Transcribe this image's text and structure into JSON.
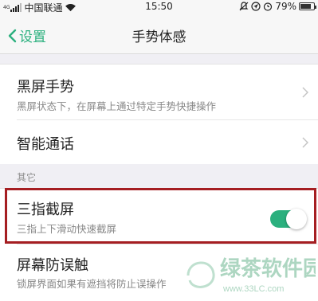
{
  "status_bar": {
    "network": "4G",
    "carrier": "中国联通",
    "time": "15:50",
    "battery": "79%",
    "battery_level": 0.79
  },
  "nav": {
    "back_label": "设置",
    "title": "手势体感"
  },
  "group1": [
    {
      "title": "黑屏手势",
      "subtitle": "黑屏状态下，在屏幕上通过特定手势快捷操作"
    },
    {
      "title": "智能通话"
    }
  ],
  "section_other": "其它",
  "group2": [
    {
      "title": "三指截屏",
      "subtitle": "三指上下滑动快速截屏",
      "toggle_on": true
    },
    {
      "title": "屏幕防误触",
      "subtitle": "锁屏界面如果有遮挡将防止误操作"
    }
  ],
  "watermark": {
    "text": "绿茶软件园",
    "url": "www.33LC.com"
  },
  "colors": {
    "accent": "#2bb07e",
    "highlight": "#a51e22"
  }
}
